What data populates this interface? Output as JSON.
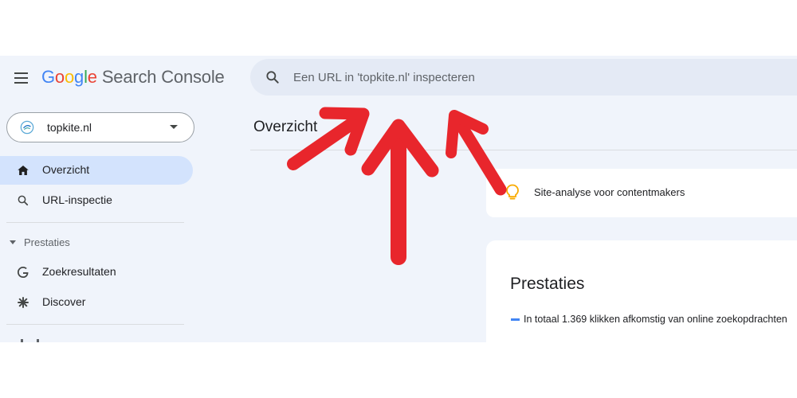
{
  "header": {
    "logo_google": [
      "G",
      "o",
      "o",
      "g",
      "l",
      "e"
    ],
    "product_name": "Search Console"
  },
  "search": {
    "placeholder": "Een URL in 'topkite.nl' inspecteren"
  },
  "property": {
    "name": "topkite.nl"
  },
  "sidebar": {
    "items": [
      {
        "label": "Overzicht",
        "icon": "home-icon",
        "active": true
      },
      {
        "label": "URL-inspectie",
        "icon": "search-icon",
        "active": false
      }
    ],
    "sections": [
      {
        "label": "Prestaties",
        "items": [
          {
            "label": "Zoekresultaten",
            "icon": "google-g-icon"
          },
          {
            "label": "Discover",
            "icon": "discover-asterisk-icon"
          }
        ]
      }
    ]
  },
  "main": {
    "page_title": "Overzicht",
    "insight_card": {
      "text": "Site-analyse voor contentmakers",
      "icon": "lightbulb-icon"
    },
    "performance_card": {
      "title": "Prestaties",
      "summary": "In totaal 1.369 klikken afkomstig van online zoekopdrachten"
    }
  },
  "colors": {
    "accent": "#4285f4",
    "active_nav": "#d3e3fd",
    "background": "#f0f4fb",
    "annotation_arrows": "#e8262c",
    "bulb": "#f9ab00"
  }
}
